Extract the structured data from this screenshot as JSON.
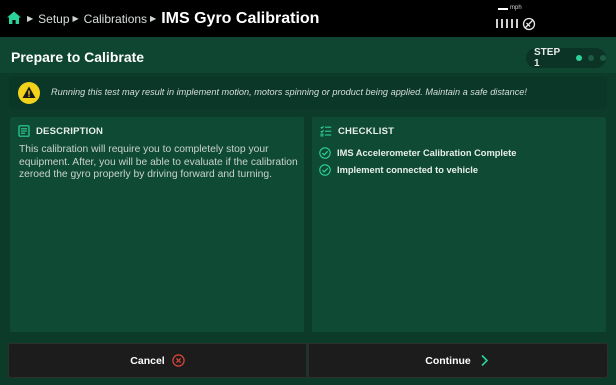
{
  "breadcrumbs": [
    "Setup",
    "Calibrations"
  ],
  "page_title": "IMS Gyro Calibration",
  "status": {
    "speed_value": "--",
    "speed_unit": "mph",
    "icons": [
      "signal-bars-icon",
      "satellite-icon"
    ]
  },
  "section_title": "Prepare to Calibrate",
  "step": {
    "label": "STEP 1",
    "current": 1,
    "total": 3
  },
  "warning": {
    "icon": "warning-icon",
    "text": "Running this test may result in implement motion, motors spinning or product being applied. Maintain a safe distance!"
  },
  "description": {
    "title": "DESCRIPTION",
    "icon": "document-icon",
    "text": "This calibration will require you to completely stop your equipment. After, you will be able to evaluate if the calibration zeroed the gyro properly by driving forward and turning."
  },
  "checklist": {
    "title": "CHECKLIST",
    "icon": "checklist-icon",
    "items": [
      {
        "label": "IMS Accelerometer Calibration Complete"
      },
      {
        "label": "Implement connected to vehicle"
      }
    ]
  },
  "buttons": {
    "cancel": "Cancel",
    "continue": "Continue"
  },
  "colors": {
    "accent": "#2bd29a",
    "warning": "#f2d21b",
    "cancel_icon": "#e0463a",
    "background": "#0c3b2a"
  }
}
